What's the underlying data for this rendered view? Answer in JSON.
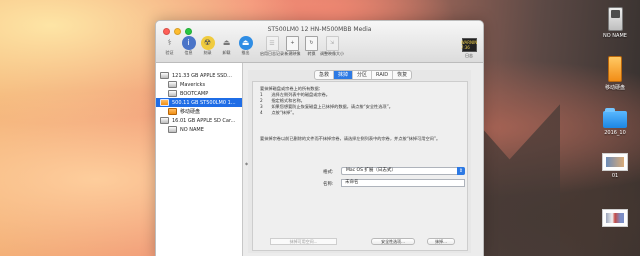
{
  "window": {
    "title": "ST500LM0 12 HN-M500MBB Media"
  },
  "toolbar": {
    "items": [
      {
        "label": "验证",
        "icon": "verify-icon"
      },
      {
        "label": "信息",
        "icon": "info-icon"
      },
      {
        "label": "刻录",
        "icon": "burn-icon"
      },
      {
        "label": "卸载",
        "icon": "unmount-icon"
      },
      {
        "label": "推出",
        "icon": "eject-icon"
      },
      {
        "label": "启用日志记录",
        "icon": "journaling-icon"
      },
      {
        "label": "新建映像",
        "icon": "new-image-icon"
      },
      {
        "label": "转换",
        "icon": "convert-icon"
      },
      {
        "label": "调整映像大小",
        "icon": "resize-image-icon"
      }
    ],
    "log_label": "日志",
    "log_icon_text": "WARNIN\n7:36"
  },
  "sidebar": {
    "items": [
      {
        "label": "121.33 GB APPLE SSD...",
        "type": "disk"
      },
      {
        "label": "Mavericks",
        "type": "volume"
      },
      {
        "label": "BOOTCAMP",
        "type": "volume"
      },
      {
        "label": "500.11 GB ST500LM0 1...",
        "type": "disk-selected"
      },
      {
        "label": "移动硬盘",
        "type": "orange-volume"
      },
      {
        "label": "16.01 GB APPLE SD Car...",
        "type": "disk"
      },
      {
        "label": "NO NAME",
        "type": "volume"
      }
    ]
  },
  "tabs": [
    "急救",
    "抹掉",
    "分区",
    "RAID",
    "恢复"
  ],
  "erase_panel": {
    "instructions": [
      "要抹掉磁盘或宗卷上的所有数据：",
      "选择左侧列表中的磁盘或宗卷。",
      "指定格式和名称。",
      "如果您想要防止恢复磁盘上已抹掉的数据，请点按“安全性选项”。",
      "点按“抹掉”。"
    ],
    "instruction_numbers": [
      "1",
      "2",
      "3",
      "4"
    ],
    "note": "要抹掉宗卷以前已删除的文件而不抹掉宗卷，请选择左侧列表中的宗卷，并点按“抹掉可用空间”。",
    "format_label": "格式:",
    "format_value": "Mac OS 扩展（日志式）",
    "name_label": "名称:",
    "name_value": "未命名",
    "erase_free_space_label": "抹掉可用空间...",
    "security_options_label": "安全性选项...",
    "erase_button_label": "抹掉..."
  },
  "desktop": {
    "icons": [
      {
        "label": "NO NAME",
        "icon": "sd-card-icon"
      },
      {
        "label": "移动硬盘",
        "icon": "external-drive-icon"
      },
      {
        "label": "2016_10",
        "icon": "folder-icon"
      },
      {
        "label": "01",
        "icon": "screenshot-thumbnail-icon"
      },
      {
        "label": "",
        "icon": "screenshot-thumbnail-icon"
      }
    ]
  }
}
